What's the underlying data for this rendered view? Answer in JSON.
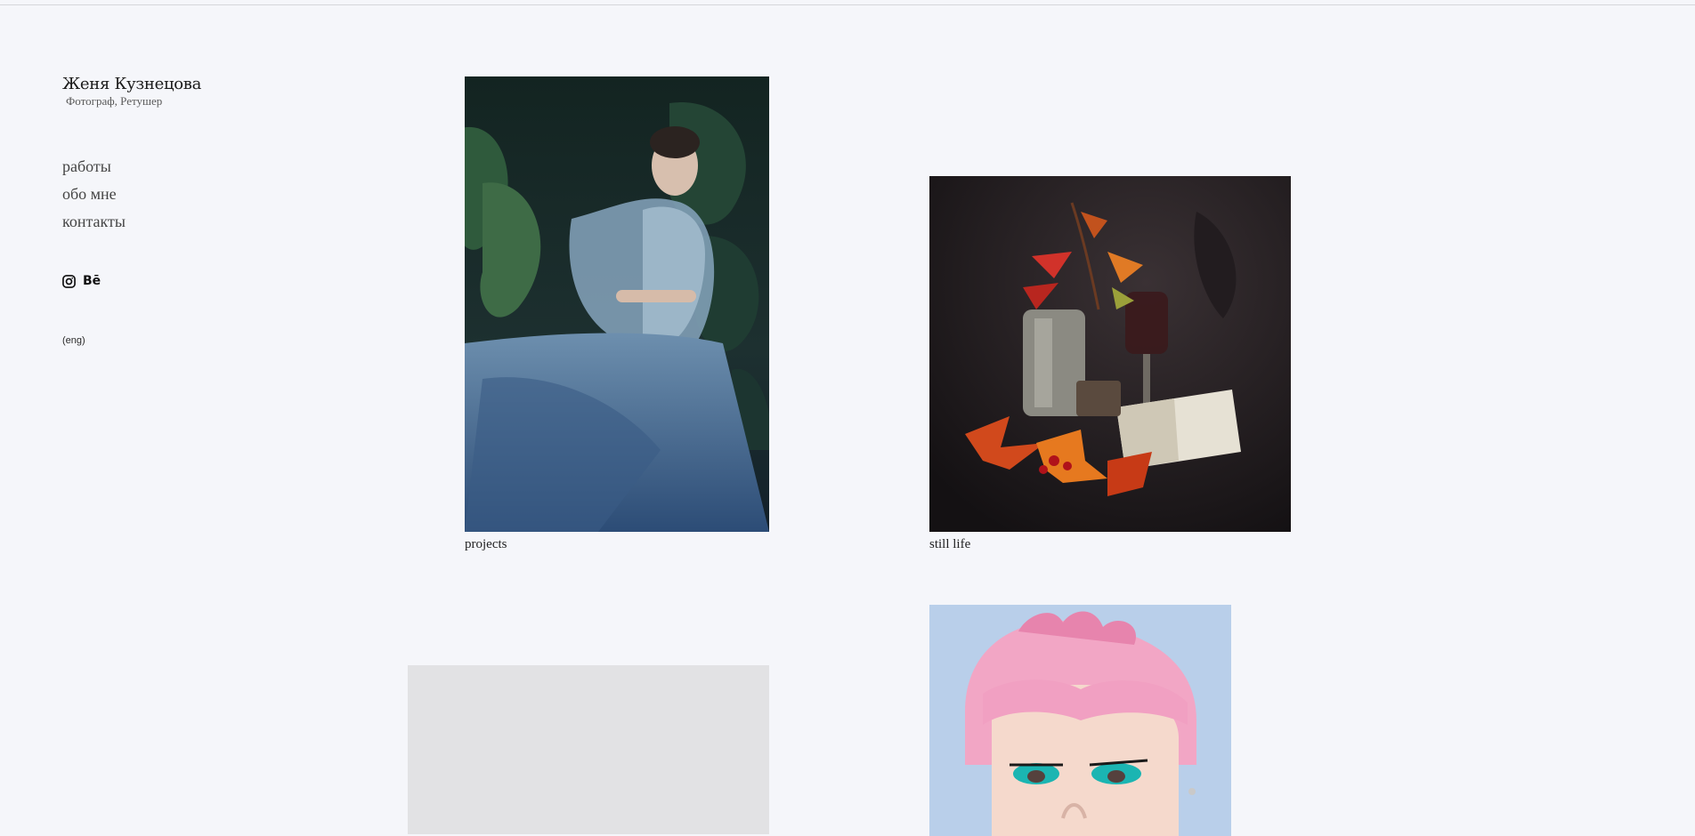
{
  "brand": {
    "name": "Женя Кузнецова",
    "subtitle": "Фотограф, Ретушер"
  },
  "nav": {
    "items": [
      {
        "label": "работы"
      },
      {
        "label": "обо мне"
      },
      {
        "label": "контакты"
      }
    ]
  },
  "social": {
    "instagram_icon": "instagram-icon",
    "behance_label": "Bē"
  },
  "language": {
    "label": "(eng)"
  },
  "gallery": {
    "items": [
      {
        "caption": "projects",
        "image": "woman in blue tulle dress among tropical leaves"
      },
      {
        "caption": "still life",
        "image": "still life with autumn leaves, metal cups, glass and open book"
      },
      {
        "caption": "",
        "image": "grey placeholder"
      },
      {
        "caption": "",
        "image": "portrait with pink hair and turquoise eye makeup"
      }
    ]
  },
  "colors": {
    "background": "#f5f6fa",
    "text": "#1c1c1c",
    "placeholder": "#e2e2e4"
  }
}
